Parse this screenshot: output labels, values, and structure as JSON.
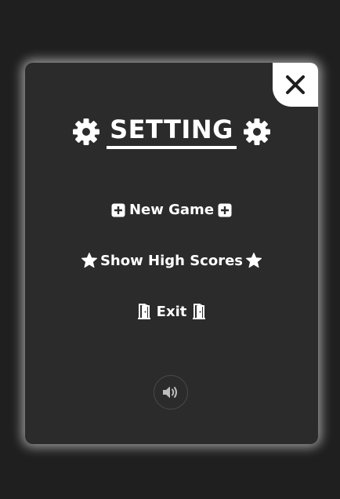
{
  "modal": {
    "title": "SETTING",
    "title_icon": "gear-icon",
    "close_icon": "close-icon"
  },
  "menu": {
    "new_game": {
      "label": "New Game",
      "icon": "plus-square-icon"
    },
    "high_scores": {
      "label": "Show High Scores",
      "icon": "star-icon"
    },
    "exit": {
      "label": "Exit",
      "icon": "door-open-icon"
    }
  },
  "sound": {
    "icon": "volume-icon"
  },
  "colors": {
    "background": "#1f1f1f",
    "panel": "#2b2b2b",
    "text": "#ffffff",
    "close_button_bg": "#ffffff",
    "close_icon": "#1e1e1e"
  }
}
